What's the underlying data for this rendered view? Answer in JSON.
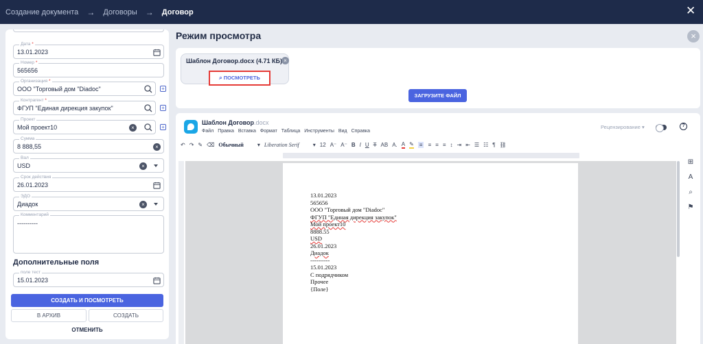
{
  "topbar": {
    "crumbs": [
      "Создание документа",
      "Договоры",
      "Договор"
    ],
    "arrow": "→",
    "close_icon": "✕"
  },
  "form": {
    "date": {
      "label": "Дата",
      "value": "13.01.2023"
    },
    "number": {
      "label": "Номер",
      "value": "565656"
    },
    "organization": {
      "label": "Организация",
      "value": "ООО \"Торговый дом \"Diadoc\""
    },
    "contractor": {
      "label": "Контрагент",
      "value": "ФГУП \"Единая дирекция закупок\""
    },
    "project": {
      "label": "Проект",
      "value": "Мой проект10"
    },
    "amount": {
      "label": "Сумма",
      "value": "8 888,55"
    },
    "currency": {
      "label": "Вал",
      "value": "USD"
    },
    "validity": {
      "label": "Срок действия",
      "value": "26.01.2023"
    },
    "edo": {
      "label": "ЭДО",
      "value": "Диадок"
    },
    "comment": {
      "label": "Комментарий",
      "value": "----------"
    },
    "extra_title": "Дополнительные поля",
    "extra_field": {
      "label": "поле тест",
      "value": "15.01.2023"
    },
    "required_mark": "*",
    "create_view_label": "СОЗДАТЬ И ПОСМОТРЕТЬ",
    "archive_label": "В АРХИВ",
    "create_label": "СОЗДАТЬ",
    "cancel_label": "ОТМЕНИТЬ"
  },
  "preview": {
    "title": "Режим просмотра",
    "file_name": "Шаблон Договор.docx (4.71 КБ)",
    "view_label": "ПОСМОТРЕТЬ",
    "upload_label": "ЗАГРУЗИТЕ ФАЙЛ"
  },
  "editor": {
    "doc_title": "Шаблон Договор",
    "doc_ext": ".docx",
    "menu": [
      "Файл",
      "Правка",
      "Вставка",
      "Формат",
      "Таблица",
      "Инструменты",
      "Вид",
      "Справка"
    ],
    "review_label": "Рецензирование",
    "style_name": "Обычный",
    "font_name": "Liberation Serif",
    "font_size": "12",
    "lines": [
      "13.01.2023",
      "565656",
      "ООО \"Торговый дом \"Diadoc\"",
      "ФГУП \"Единая дирекция закупок\"",
      "Мой проект10",
      "8888.55",
      "USD",
      "26.01.2023",
      "Диадок",
      "----------",
      "15.01.2023",
      "С подрядчиком",
      "Прочее",
      "{Поле}"
    ]
  }
}
